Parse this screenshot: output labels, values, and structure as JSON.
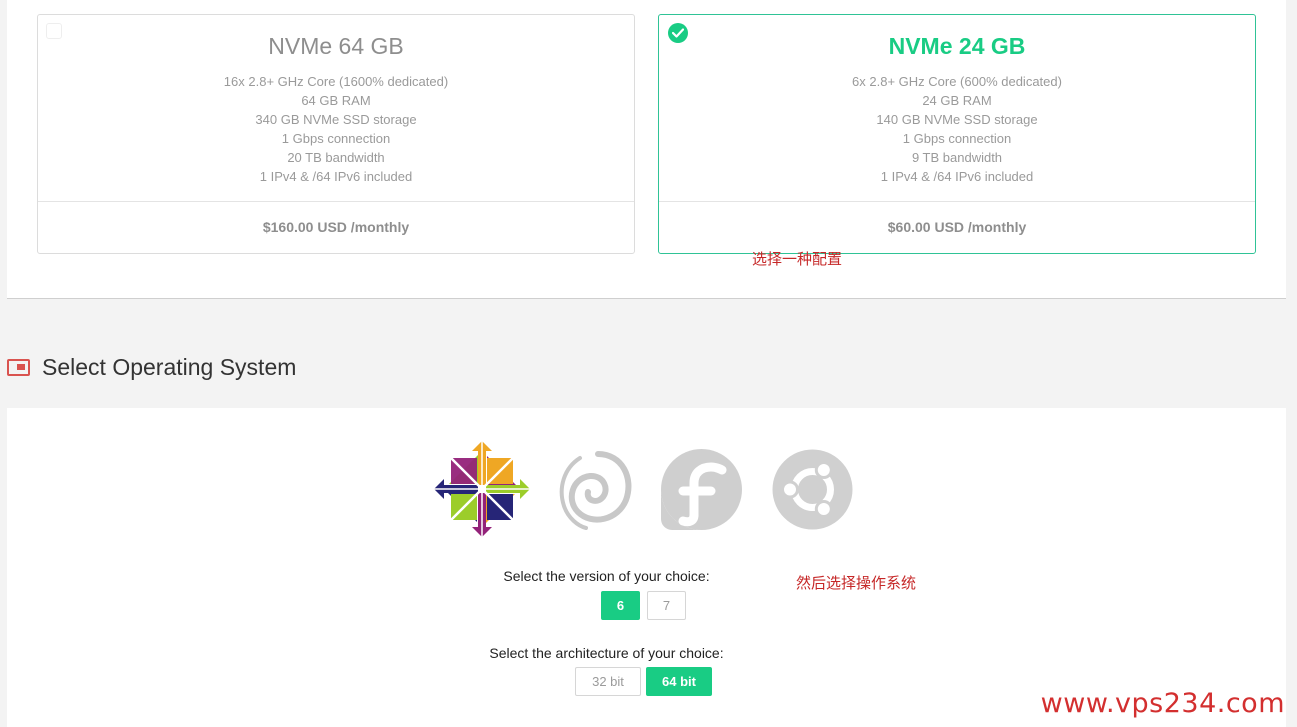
{
  "plans": [
    {
      "name": "NVMe 64 GB",
      "selected": false,
      "specs": [
        "16x 2.8+ GHz Core (1600% dedicated)",
        "64 GB RAM",
        "340 GB NVMe SSD storage",
        "1 Gbps connection",
        "20 TB bandwidth",
        "1 IPv4 & /64 IPv6 included"
      ],
      "price": "$160.00 USD /monthly"
    },
    {
      "name": "NVMe 24 GB",
      "selected": true,
      "specs": [
        "6x 2.8+ GHz Core (600% dedicated)",
        "24 GB RAM",
        "140 GB NVMe SSD storage",
        "1 Gbps connection",
        "9 TB bandwidth",
        "1 IPv4 & /64 IPv6 included"
      ],
      "price": "$60.00 USD /monthly"
    }
  ],
  "annotations": {
    "choose_config": "选择一种配置",
    "choose_os": "然后选择操作系统"
  },
  "os_section": {
    "title": "Select Operating System",
    "icon": "window-icon",
    "logos": [
      "centos-logo",
      "debian-logo",
      "fedora-logo",
      "ubuntu-logo"
    ],
    "selected_os": "centos-logo",
    "version_label": "Select the version of your choice:",
    "versions": [
      "6",
      "7"
    ],
    "selected_version": "6",
    "arch_label": "Select the architecture of your choice:",
    "architectures": [
      "32 bit",
      "64 bit"
    ],
    "selected_arch": "64 bit"
  },
  "watermark": "www.vps234.com",
  "colors": {
    "accent": "#19cc84",
    "annotation": "#c62828",
    "section_icon": "#d9534f"
  }
}
